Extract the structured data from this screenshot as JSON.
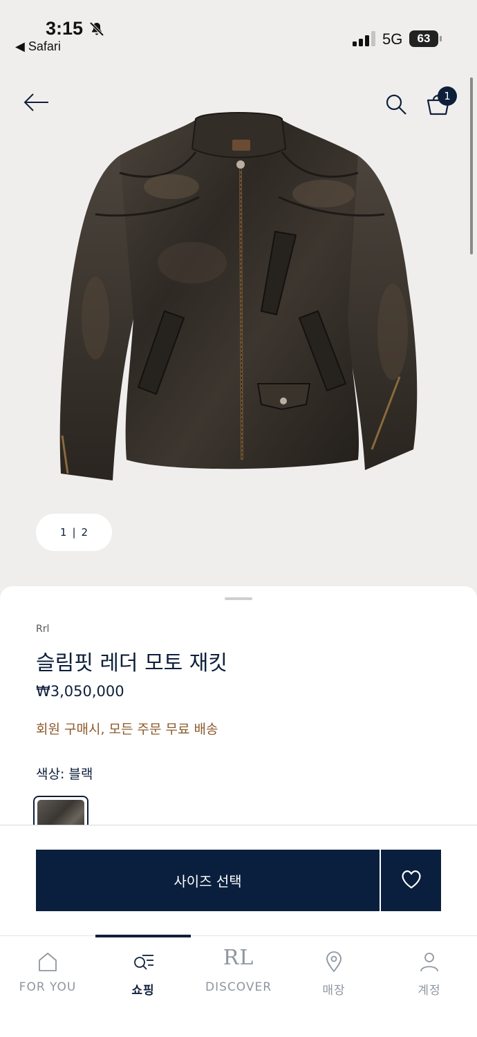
{
  "status_bar": {
    "time": "3:15",
    "back_app": "◀ Safari",
    "network": "5G",
    "battery": "63"
  },
  "nav": {
    "cart_count": "1"
  },
  "gallery": {
    "current_page": "1",
    "separator": "|",
    "total_pages": "2"
  },
  "product": {
    "brand": "Rrl",
    "title": "슬림핏 레더 모토 재킷",
    "price": "₩3,050,000",
    "shipping_note": "회원 구매시, 모든 주문 무료 배송",
    "color_label": "색상:  블랙"
  },
  "actions": {
    "size_select_label": "사이즈 선택"
  },
  "tabs": [
    {
      "label": "FOR YOU",
      "icon": "home-icon"
    },
    {
      "label": "쇼핑",
      "icon": "shopping-search-icon",
      "active": true
    },
    {
      "label": "DISCOVER",
      "icon": "rl-logo-icon",
      "logo": "RL"
    },
    {
      "label": "매장",
      "icon": "location-pin-icon"
    },
    {
      "label": "계정",
      "icon": "account-icon"
    }
  ],
  "colors": {
    "navy": "#0a1f3d",
    "shipping_brown": "#8b5a2b",
    "background": "#f0eeed"
  }
}
